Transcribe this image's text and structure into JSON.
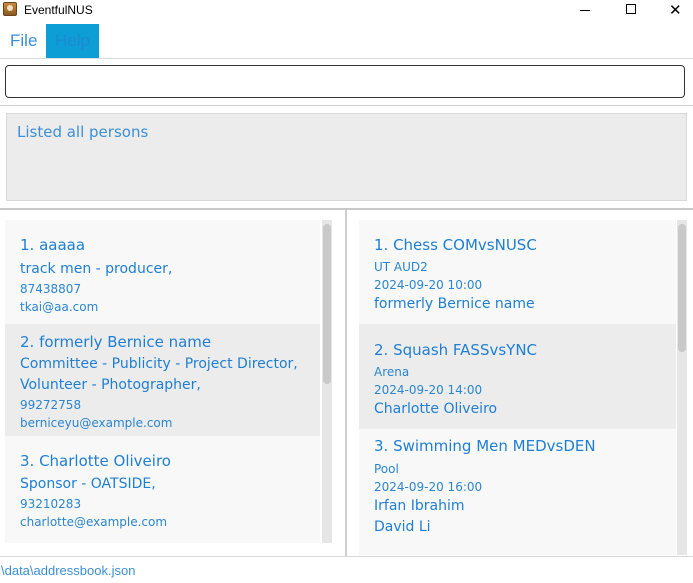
{
  "window": {
    "title": "EventfulNUS"
  },
  "menu": {
    "file": "File",
    "help": "Help"
  },
  "command": {
    "value": ""
  },
  "result": {
    "text": "Listed all persons"
  },
  "persons": [
    {
      "title": "1. aaaaa",
      "roles": [
        "track men - producer,"
      ],
      "phone": "87438807",
      "email": "tkai@aa.com"
    },
    {
      "title": "2. formerly Bernice name",
      "roles": [
        "Committee - Publicity - Project Director,",
        "Volunteer - Photographer,"
      ],
      "phone": "99272758",
      "email": "berniceyu@example.com"
    },
    {
      "title": "3. Charlotte Oliveiro",
      "roles": [
        "Sponsor - OATSIDE,"
      ],
      "phone": "93210283",
      "email": "charlotte@example.com"
    }
  ],
  "events": [
    {
      "title": "1. Chess COMvsNUSC",
      "venue": "UT AUD2",
      "time": "2024-09-20 10:00",
      "participants": [
        "formerly Bernice name"
      ]
    },
    {
      "title": "2. Squash FASSvsYNC",
      "venue": "Arena",
      "time": "2024-09-20 14:00",
      "participants": [
        "Charlotte Oliveiro"
      ]
    },
    {
      "title": "3. Swimming Men MEDvsDEN",
      "venue": "Pool",
      "time": "2024-09-20 16:00",
      "participants": [
        "Irfan Ibrahim",
        "David Li"
      ]
    }
  ],
  "status": {
    "path": "\\data\\addressbook.json"
  }
}
